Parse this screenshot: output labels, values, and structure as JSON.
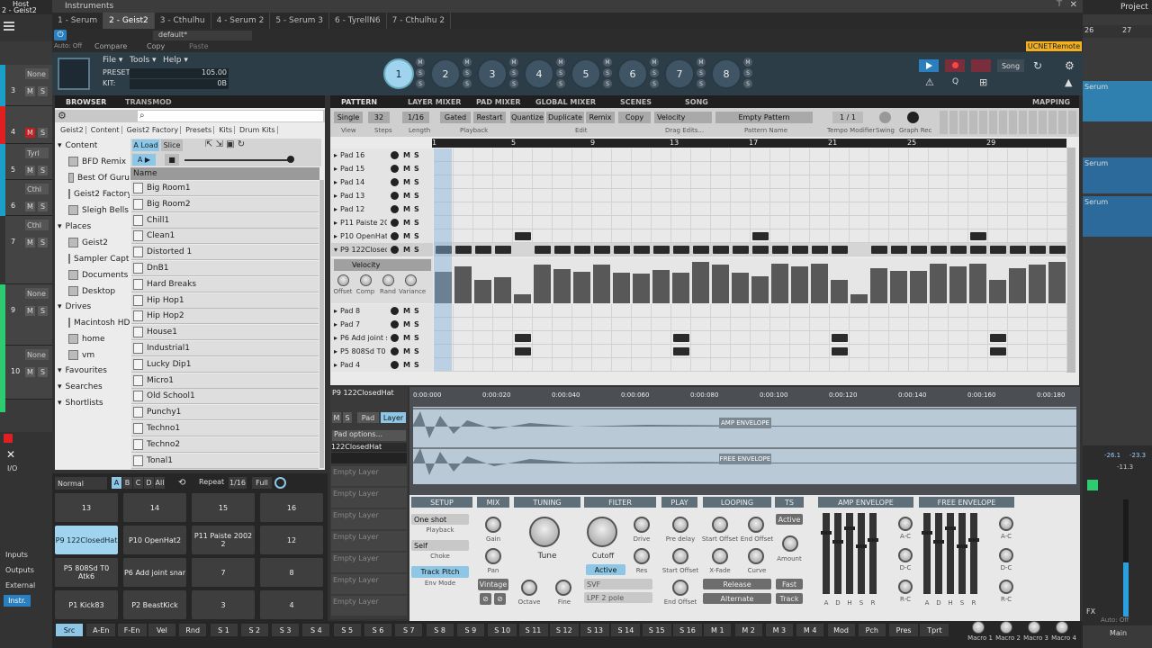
{
  "window": {
    "title": "Instruments",
    "host_label": "Host",
    "track_label": "2 - Geist2"
  },
  "tabs": [
    "1 - Serum",
    "2 - Geist2",
    "3 - Cthulhu",
    "4 - Serum 2",
    "5 - Serum 3",
    "6 - TyrellN6",
    "7 - Cthulhu 2"
  ],
  "host_bar": {
    "power": "⏻",
    "preset": "default*",
    "auto_off": "Auto: Off",
    "compare": "Compare",
    "copy": "Copy",
    "paste": "Paste",
    "remote": "UCNETRemote"
  },
  "right_panel": {
    "project": "Project",
    "ruler": [
      "26",
      "27"
    ],
    "serum_labels": [
      "Serum",
      "Serum",
      "Serum",
      "Serum"
    ],
    "db": [
      "-26.1",
      "-23.3",
      "-11.3"
    ],
    "main": "Main",
    "fx": "FX",
    "auto_off": "Auto: Off"
  },
  "daw_left": {
    "tracks": [
      {
        "num": "3",
        "color": "#1aa0c8",
        "none": "None"
      },
      {
        "num": "4",
        "color": "#e02020",
        "none": ""
      },
      {
        "num": "5",
        "color": "#1aa0c8",
        "none": "Tyrl"
      },
      {
        "num": "6",
        "color": "#1aa0c8",
        "none": "Cthl"
      },
      {
        "num": "7",
        "color": "#333333",
        "none": "Cthl"
      },
      {
        "num": "9",
        "color": "#2ecc71",
        "none": "None"
      },
      {
        "num": "10",
        "color": "#2ecc71",
        "none": "None"
      }
    ],
    "io": "I/O",
    "inputs": "Inputs",
    "outputs": "Outputs",
    "external": "External",
    "instr": "Instr."
  },
  "geist_menu": {
    "file": "File ▾",
    "tools": "Tools ▾",
    "help": "Help ▾",
    "preset_label": "PRESET:",
    "preset_value": "105.00",
    "kit_label": "KIT:",
    "kit_value": "0B",
    "song": "Song"
  },
  "engines": [
    "1",
    "2",
    "3",
    "4",
    "5",
    "6",
    "7",
    "8"
  ],
  "browser": {
    "tabs": [
      "BROWSER",
      "TRANSMOD"
    ],
    "breadcrumb": [
      "Geist2",
      "Content",
      "Geist2 Factory",
      "Presets",
      "Kits",
      "Drum Kits"
    ],
    "tree": {
      "content": "Content",
      "content_items": [
        "BFD Remix",
        "Best Of Guru",
        "Geist2 Factory",
        "Sleigh Bells"
      ],
      "places": "Places",
      "places_items": [
        "Geist2",
        "Sampler Capture",
        "Documents",
        "Desktop"
      ],
      "drives": "Drives",
      "drives_items": [
        "Macintosh HD",
        "home",
        "vm"
      ],
      "favourites": "Favourites",
      "searches": "Searches",
      "shortlists": "Shortlists"
    },
    "load": "A Load",
    "slice": "Slice",
    "name_col": "Name",
    "items": [
      "Big Room1",
      "Big Room2",
      "Chill1",
      "Clean1",
      "Distorted 1",
      "DnB1",
      "Hard Breaks",
      "Hip Hop1",
      "Hip Hop2",
      "House1",
      "Industrial1",
      "Lucky Dip1",
      "Micro1",
      "Old School1",
      "Punchy1",
      "Techno1",
      "Techno2",
      "Tonal1"
    ]
  },
  "pattern": {
    "tabs": [
      "PATTERN",
      "LAYER MIXER",
      "PAD MIXER",
      "GLOBAL MIXER",
      "SCENES",
      "SONG",
      "MAPPING"
    ],
    "view": "Single",
    "steps": "32",
    "length": "1/16",
    "view_lbl": "View",
    "steps_lbl": "Steps",
    "length_lbl": "Length",
    "playback": [
      "Gated",
      "Restart"
    ],
    "playback_lbl": "Playback",
    "edit": [
      "Quantize",
      "Duplicate",
      "Remix",
      "Copy"
    ],
    "edit_lbl": "Edit",
    "drag": "Velocity",
    "drag_lbl": "Drag Edits...",
    "pattern_name": "Empty Pattern",
    "pattern_name_lbl": "Pattern Name",
    "tempo": "1 / 1",
    "tempo_lbl": "Tempo Modifier",
    "swing_lbl": "Swing",
    "graph_lbl": "Graph Rec",
    "bars": [
      "1",
      "5",
      "9",
      "13",
      "17",
      "21",
      "25",
      "29"
    ],
    "rows": [
      "Pad 16",
      "Pad 15",
      "Pad 14",
      "Pad 13",
      "Pad 12",
      "P11 Paiste 2002 20",
      "P10 OpenHat2",
      "P9 122ClosedHat"
    ],
    "rows_below": [
      "Pad 8",
      "Pad 7",
      "P6 Add joint snare",
      "P5 808Sd T0 Atk6",
      "Pad 4"
    ],
    "velocity_lbl": "Velocity",
    "vel_knobs": [
      "Offset",
      "Comp",
      "Rand",
      "Variance"
    ],
    "velocity_values": [
      0.72,
      0.85,
      0.55,
      0.6,
      0.2,
      0.9,
      0.8,
      0.72,
      0.9,
      0.7,
      0.68,
      0.78,
      0.7,
      0.95,
      0.9,
      0.7,
      0.62,
      0.92,
      0.85,
      0.92,
      0.55,
      0.2,
      0.82,
      0.75,
      0.75,
      0.92,
      0.85,
      0.92,
      0.55,
      0.82,
      0.9,
      0.95
    ]
  },
  "pads": {
    "mode": "Normal",
    "banks": [
      "A",
      "B",
      "C",
      "D",
      "All"
    ],
    "repeat": "Repeat",
    "repeat_val": "1/16",
    "full": "Full",
    "grid": [
      [
        "13",
        "14",
        "15",
        "16"
      ],
      [
        "P9 122ClosedHat",
        "P10 OpenHat2",
        "P11 Paiste 2002 2",
        "12"
      ],
      [
        "P5 808Sd T0 Atk6",
        "P6 Add joint snar",
        "7",
        "8"
      ],
      [
        "P1 Kick83",
        "P2 BeastKick",
        "3",
        "4"
      ]
    ]
  },
  "layer": {
    "pad_name": "P9 122ClosedHat",
    "btns": [
      "M",
      "S",
      "Pad",
      "Layer"
    ],
    "options": "Pad options...",
    "layer_name": "122ClosedHat",
    "empty": "Empty Layer"
  },
  "timeline": [
    "0:00:000",
    "0:00:020",
    "0:00:040",
    "0:00:060",
    "0:00:080",
    "0:00:100",
    "0:00:120",
    "0:00:140",
    "0:00:160",
    "0:00:180"
  ],
  "envelopes": {
    "amp": "AMP ENVELOPE",
    "free": "FREE ENVELOPE"
  },
  "sections": {
    "setup": {
      "hdr": "SETUP",
      "one_shot": "One shot",
      "playback": "Playback",
      "self": "Self",
      "choke": "Choke",
      "track_pitch": "Track Pitch",
      "env_mode": "Env Mode"
    },
    "mix": {
      "hdr": "MIX",
      "gain": "Gain",
      "pan": "Pan",
      "vintage": "Vintage"
    },
    "tuning": {
      "hdr": "TUNING",
      "tune": "Tune",
      "octave": "Octave",
      "fine": "Fine"
    },
    "filter": {
      "hdr": "FILTER",
      "cutoff": "Cutoff",
      "drive": "Drive",
      "res": "Res",
      "active": "Active",
      "svf": "SVF",
      "lpf": "LPF 2 pole"
    },
    "play": {
      "hdr": "PLAY",
      "pre_delay": "Pre delay",
      "start_offset": "Start Offset",
      "end_offset": "End Offset"
    },
    "looping": {
      "hdr": "LOOPING",
      "start_offset": "Start Offset",
      "end_offset": "End Offset",
      "x_fade": "X-Fade",
      "curve": "Curve",
      "release": "Release",
      "alternate": "Alternate"
    },
    "ts": {
      "hdr": "TS",
      "active": "Active",
      "amount": "Amount",
      "fast": "Fast",
      "track": "Track"
    },
    "amp_env": {
      "hdr": "AMP ENVELOPE",
      "labels": [
        "A",
        "D",
        "H",
        "S",
        "R"
      ],
      "ac": "A-C",
      "dc": "D-C",
      "rc": "R-C"
    },
    "free_env": {
      "hdr": "FREE ENVELOPE",
      "labels": [
        "A",
        "D",
        "H",
        "S",
        "R"
      ],
      "ac": "A-C",
      "dc": "D-C",
      "rc": "R-C"
    }
  },
  "bottom_bar": [
    "Src",
    "A-En",
    "F-En",
    "Vel",
    "Rnd",
    "S 1",
    "S 2",
    "S 3",
    "S 4",
    "S 5",
    "S 6",
    "S 7",
    "S 8",
    "S 9",
    "S 10",
    "S 11",
    "S 12",
    "S 13",
    "S 14",
    "S 15",
    "S 16",
    "M 1",
    "M 2",
    "M 3",
    "M 4",
    "Mod",
    "Pch",
    "Pres",
    "Tprt"
  ],
  "macros": [
    "Macro 1",
    "Macro 2",
    "Macro 3",
    "Macro 4"
  ]
}
